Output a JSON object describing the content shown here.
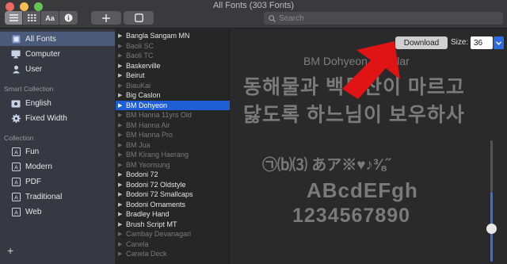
{
  "window": {
    "title": "All Fonts (303 Fonts)"
  },
  "toolbar": {
    "search_placeholder": "Search",
    "view_buttons": [
      "list-view",
      "grid-view",
      "sample-view",
      "info"
    ],
    "sample_label": "Aa"
  },
  "sidebar": {
    "library_items": [
      {
        "label": "All Fonts",
        "icon": "font-book-icon",
        "selected": true
      },
      {
        "label": "Computer",
        "icon": "monitor-icon"
      },
      {
        "label": "User",
        "icon": "user-icon"
      }
    ],
    "smart_collection_header": "Smart Collection",
    "smart_items": [
      {
        "label": "English",
        "icon": "folder-gear-icon"
      },
      {
        "label": "Fixed Width",
        "icon": "gear-icon"
      }
    ],
    "collection_header": "Collection",
    "collection_items": [
      {
        "label": "Fun",
        "icon": "font-collection-icon"
      },
      {
        "label": "Modern",
        "icon": "font-collection-icon"
      },
      {
        "label": "PDF",
        "icon": "font-collection-icon"
      },
      {
        "label": "Traditional",
        "icon": "font-collection-icon"
      },
      {
        "label": "Web",
        "icon": "font-collection-icon"
      }
    ],
    "add_label": "+"
  },
  "font_list": [
    {
      "name": "Bangla Sangam MN",
      "dim": false
    },
    {
      "name": "Baoli SC",
      "dim": true
    },
    {
      "name": "Baoli TC",
      "dim": true
    },
    {
      "name": "Baskerville",
      "dim": false
    },
    {
      "name": "Beirut",
      "dim": false
    },
    {
      "name": "BiauKai",
      "dim": true
    },
    {
      "name": "Big Caslon",
      "dim": false
    },
    {
      "name": "BM Dohyeon",
      "dim": false,
      "selected": true
    },
    {
      "name": "BM Hanna 11yrs Old",
      "dim": true
    },
    {
      "name": "BM Hanna Air",
      "dim": true
    },
    {
      "name": "BM Hanna Pro",
      "dim": true
    },
    {
      "name": "BM Jua",
      "dim": true
    },
    {
      "name": "BM Kirang Haerang",
      "dim": true
    },
    {
      "name": "BM Yeonsung",
      "dim": true
    },
    {
      "name": "Bodoni 72",
      "dim": false
    },
    {
      "name": "Bodoni 72 Oldstyle",
      "dim": false
    },
    {
      "name": "Bodoni 72 Smallcaps",
      "dim": false
    },
    {
      "name": "Bodoni Ornaments",
      "dim": false
    },
    {
      "name": "Bradley Hand",
      "dim": false
    },
    {
      "name": "Brush Script MT",
      "dim": false
    },
    {
      "name": "Cambay Devanagari",
      "dim": true
    },
    {
      "name": "Canela",
      "dim": true
    },
    {
      "name": "Canela Deck",
      "dim": true
    }
  ],
  "preview": {
    "download_label": "Download",
    "size_label": "Size:",
    "size_value": "36",
    "font_name": "BM Dohyeon Regular",
    "korean_line_1": "동해물과 백두산이 마르고",
    "korean_line_2": "닳도록 하느님이 보우하사",
    "symbols_line": "㉠⒝⑶  あア※♥♪⅜˝",
    "alpha_line": "ABcdEFgh",
    "digits_line": "1234567890"
  },
  "colors": {
    "selection_blue": "#1f5fd6",
    "arrow_red": "#e01414"
  }
}
